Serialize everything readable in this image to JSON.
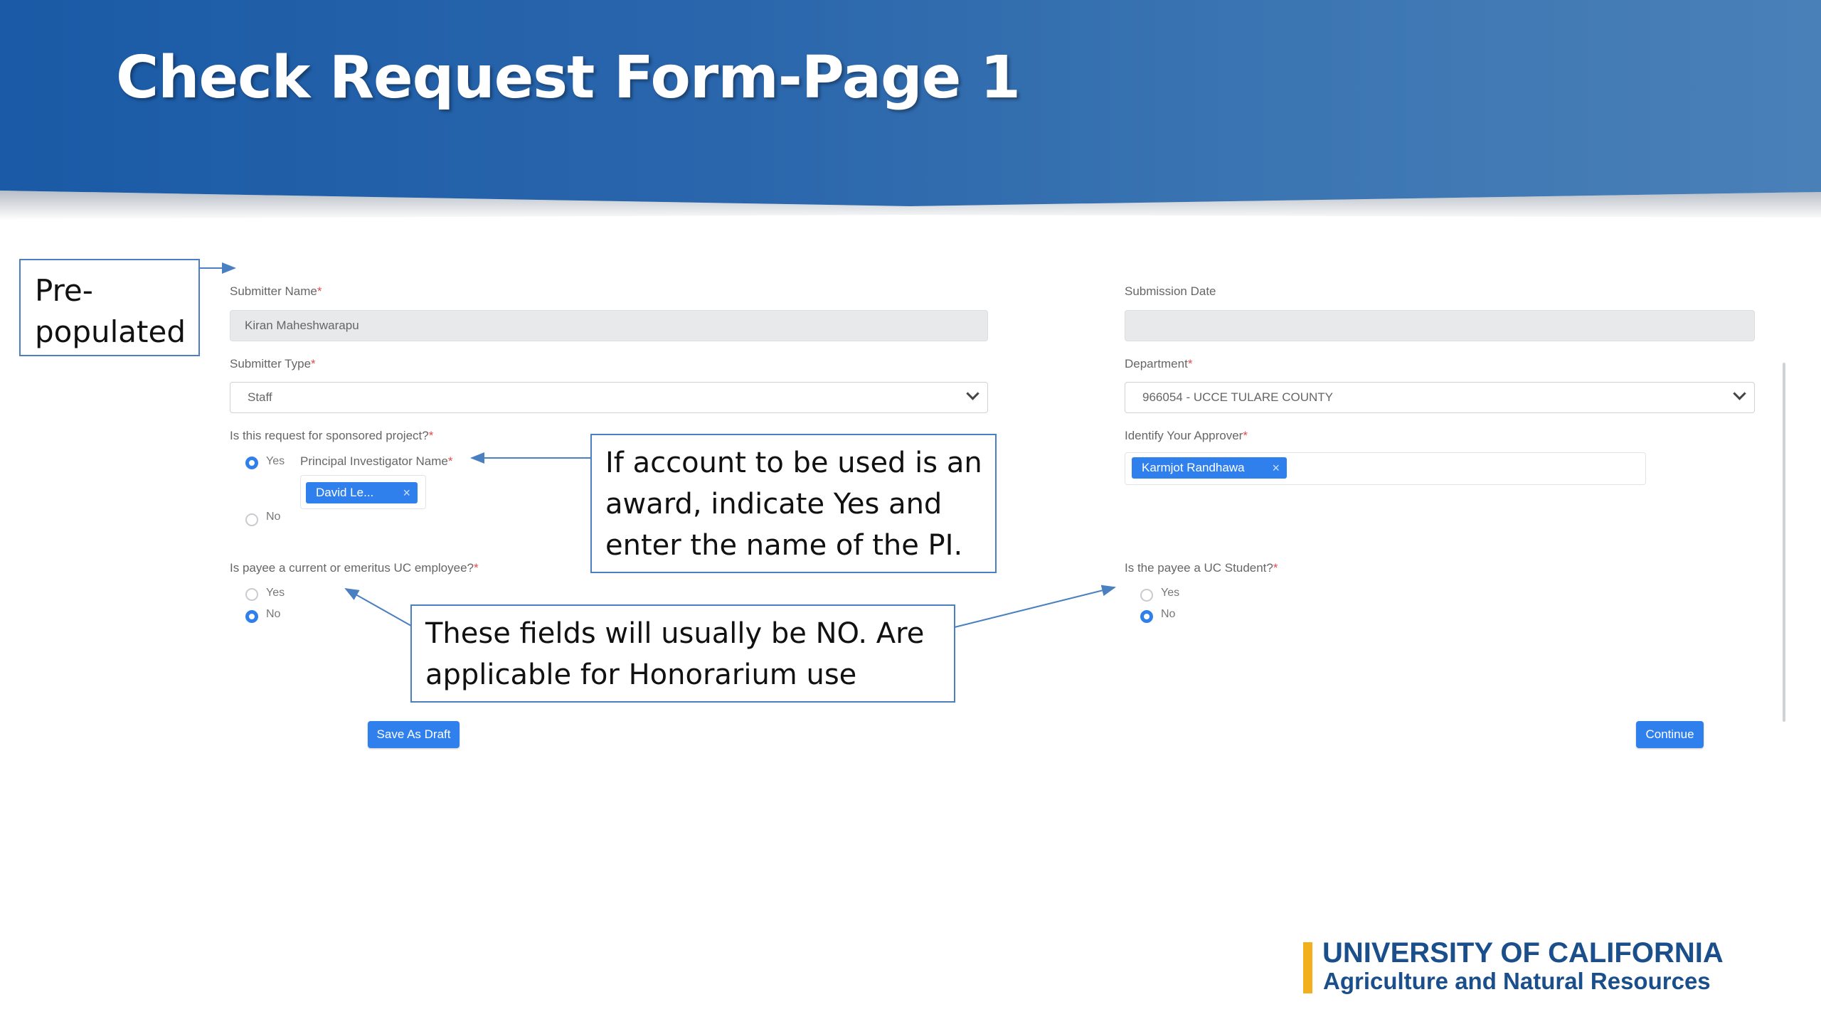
{
  "slide": {
    "title": "Check Request Form-Page 1"
  },
  "form": {
    "submitter_name_label": "Submitter Name",
    "submitter_name_value": "Kiran Maheshwarapu",
    "submission_date_label": "Submission Date",
    "submission_date_value": "",
    "submitter_type_label": "Submitter Type",
    "submitter_type_value": "Staff",
    "department_label": "Department",
    "department_value": "966054 - UCCE TULARE COUNTY",
    "sponsored_question": "Is this request for sponsored project?",
    "sponsored_options": [
      "Yes",
      "No"
    ],
    "sponsored_selected": "Yes",
    "pi_label": "Principal Investigator Name",
    "pi_chip": "David Le...",
    "approver_label": "Identify Your Approver",
    "approver_chip": "Karmjot Randhawa",
    "uc_employee_question": "Is payee a current or emeritus UC employee?",
    "uc_employee_options": [
      "Yes",
      "No"
    ],
    "uc_employee_selected": "No",
    "uc_student_question": "Is the payee a UC Student?",
    "uc_student_options": [
      "Yes",
      "No"
    ],
    "uc_student_selected": "No",
    "required_mark": "*",
    "chip_remove": "×",
    "save_draft_label": "Save As Draft",
    "continue_label": "Continue"
  },
  "callouts": {
    "prepopulated": [
      "Pre-",
      "populated"
    ],
    "award": [
      "If account to be used is an",
      "award, indicate Yes and",
      "enter the name of the PI."
    ],
    "honorarium": [
      "These fields will usually be NO. Are",
      "applicable for Honorarium use"
    ]
  },
  "logo": {
    "line1": "UNIVERSITY OF CALIFORNIA",
    "line2": "Agriculture and Natural Resources"
  },
  "colors": {
    "banner": "#1a5aa6",
    "accent": "#2f80ed",
    "callout_border": "#4a7fc1",
    "logo_blue": "#1b4f8c",
    "logo_gold": "#f2b01e"
  }
}
